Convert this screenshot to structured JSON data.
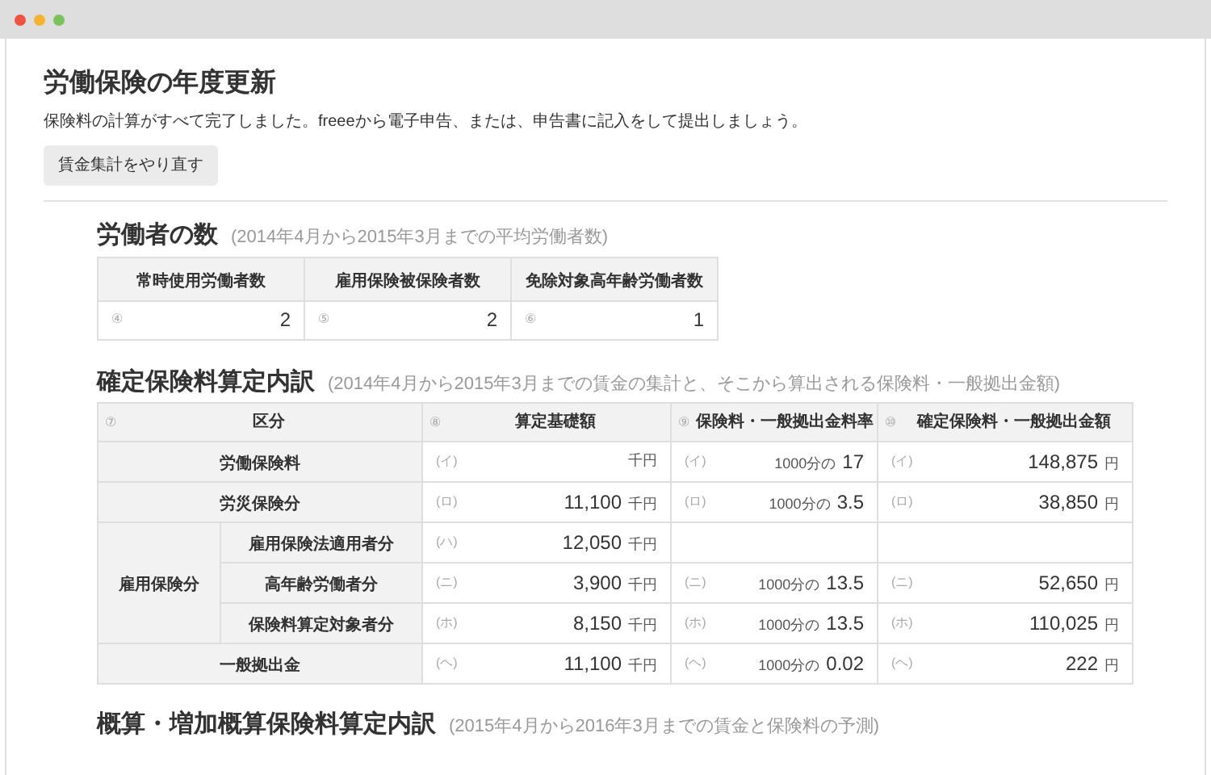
{
  "page": {
    "title": "労働保険の年度更新",
    "description": "保険料の計算がすべて完了しました。freeeから電子申告、または、申告書に記入をして提出しましょう。",
    "redo_button": "賃金集計をやり直す"
  },
  "workers": {
    "title": "労働者の数",
    "note": "(2014年4月から2015年3月までの平均労働者数)",
    "columns": [
      "常時使用労働者数",
      "雇用保険被保険者数",
      "免除対象高年齢労働者数"
    ],
    "cells": [
      {
        "index": "④",
        "value": "2"
      },
      {
        "index": "⑤",
        "value": "2"
      },
      {
        "index": "⑥",
        "value": "1"
      }
    ]
  },
  "breakdown": {
    "title": "確定保険料算定内訳",
    "note": "(2014年4月から2015年3月までの賃金の集計と、そこから算出される保険料・一般拠出金額)",
    "columns": [
      {
        "index": "⑦",
        "label": "区分"
      },
      {
        "index": "⑧",
        "label": "算定基礎額"
      },
      {
        "index": "⑨",
        "label": "保険料・一般拠出金料率"
      },
      {
        "index": "⑩",
        "label": "確定保険料・一般拠出金額"
      }
    ],
    "rows": [
      {
        "kind": "single",
        "label": "労働保険料",
        "base": {
          "index": "(イ)",
          "unit": "千円"
        },
        "rate": {
          "index": "(イ)",
          "prefix": "1000分の",
          "value": "17"
        },
        "fee": {
          "index": "(イ)",
          "amount": "148,875",
          "unit": "円"
        }
      },
      {
        "kind": "single",
        "label": "労災保険分",
        "base": {
          "index": "(ロ)",
          "amount": "11,100",
          "unit": "千円"
        },
        "rate": {
          "index": "(ロ)",
          "prefix": "1000分の",
          "value": "3.5"
        },
        "fee": {
          "index": "(ロ)",
          "amount": "38,850",
          "unit": "円"
        }
      },
      {
        "kind": "group",
        "label": "雇用保険分",
        "children": [
          {
            "label": "雇用保険法適用者分",
            "base": {
              "index": "(ハ)",
              "amount": "12,050",
              "unit": "千円"
            }
          },
          {
            "label": "高年齢労働者分",
            "base": {
              "index": "(ニ)",
              "amount": "3,900",
              "unit": "千円"
            },
            "rate": {
              "index": "(ニ)",
              "prefix": "1000分の",
              "value": "13.5"
            },
            "fee": {
              "index": "(ニ)",
              "amount": "52,650",
              "unit": "円"
            }
          },
          {
            "label": "保険料算定対象者分",
            "base": {
              "index": "(ホ)",
              "amount": "8,150",
              "unit": "千円"
            },
            "rate": {
              "index": "(ホ)",
              "prefix": "1000分の",
              "value": "13.5"
            },
            "fee": {
              "index": "(ホ)",
              "amount": "110,025",
              "unit": "円"
            }
          }
        ]
      },
      {
        "kind": "single",
        "label": "一般拠出金",
        "base": {
          "index": "(ヘ)",
          "amount": "11,100",
          "unit": "千円"
        },
        "rate": {
          "index": "(ヘ)",
          "prefix": "1000分の",
          "value": "0.02"
        },
        "fee": {
          "index": "(ヘ)",
          "amount": "222",
          "unit": "円"
        }
      }
    ]
  },
  "estimate": {
    "title": "概算・増加概算保険料算定内訳",
    "note": "(2015年4月から2016年3月までの賃金と保険料の予測)"
  }
}
